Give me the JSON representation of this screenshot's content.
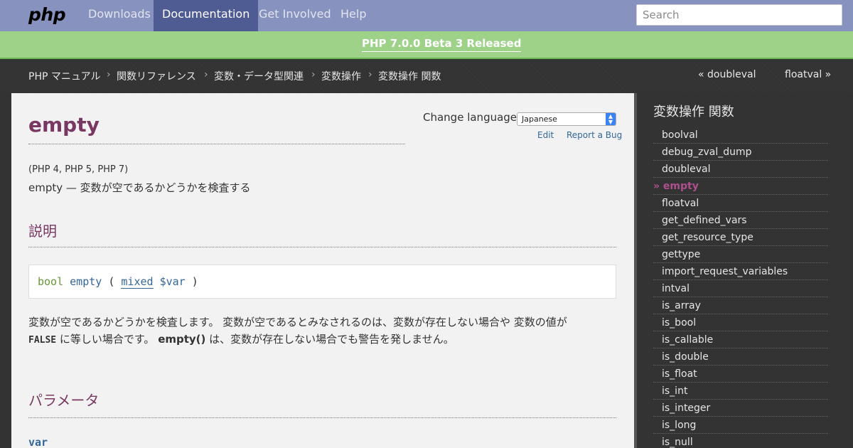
{
  "navbar": {
    "logo": "php",
    "items": [
      "Downloads",
      "Documentation",
      "Get Involved",
      "Help"
    ],
    "search_placeholder": "Search"
  },
  "headline": {
    "label": "PHP 7.0.0 Beta 3 Released"
  },
  "breadcrumb": {
    "items": [
      "PHP マニュアル",
      "関数リファレンス",
      "変数・データ型関連",
      "変数操作",
      "変数操作 関数"
    ],
    "separator": "›",
    "prev": "« doubleval",
    "next": "floatval »"
  },
  "page": {
    "title": "empty",
    "change_language_label": "Change language:",
    "language_selected": "Japanese",
    "edit_label": "Edit",
    "report_bug_label": "Report a Bug",
    "versions": "(PHP 4, PHP 5, PHP 7)",
    "refpurpose": "empty — 変数が空であるかどうかを検査する",
    "description_heading": "説明",
    "synopsis": {
      "return_type": "bool",
      "name": "empty",
      "open": "(",
      "param_type": "mixed",
      "param_name": "$var",
      "close": ")"
    },
    "description_text_1": "変数が空であるかどうかを検査します。 変数が空であるとみなされるのは、変数が存在しない場合や 変数の値が",
    "const_false": "FALSE",
    "description_text_2": " に等しい場合です。 ",
    "empty_fn": "empty()",
    "description_text_3": " は、変数が存在しない場合でも警告を発しません。",
    "parameters_heading": "パラメータ",
    "param_term": "var"
  },
  "sidebar": {
    "title": "変数操作 関数",
    "current_marker": "» ",
    "items": [
      "boolval",
      "debug_zval_dump",
      "doubleval",
      "empty",
      "floatval",
      "get_defined_vars",
      "get_resource_type",
      "gettype",
      "import_request_variables",
      "intval",
      "is_array",
      "is_bool",
      "is_callable",
      "is_double",
      "is_float",
      "is_int",
      "is_integer",
      "is_long",
      "is_null"
    ],
    "current_index": 3
  }
}
